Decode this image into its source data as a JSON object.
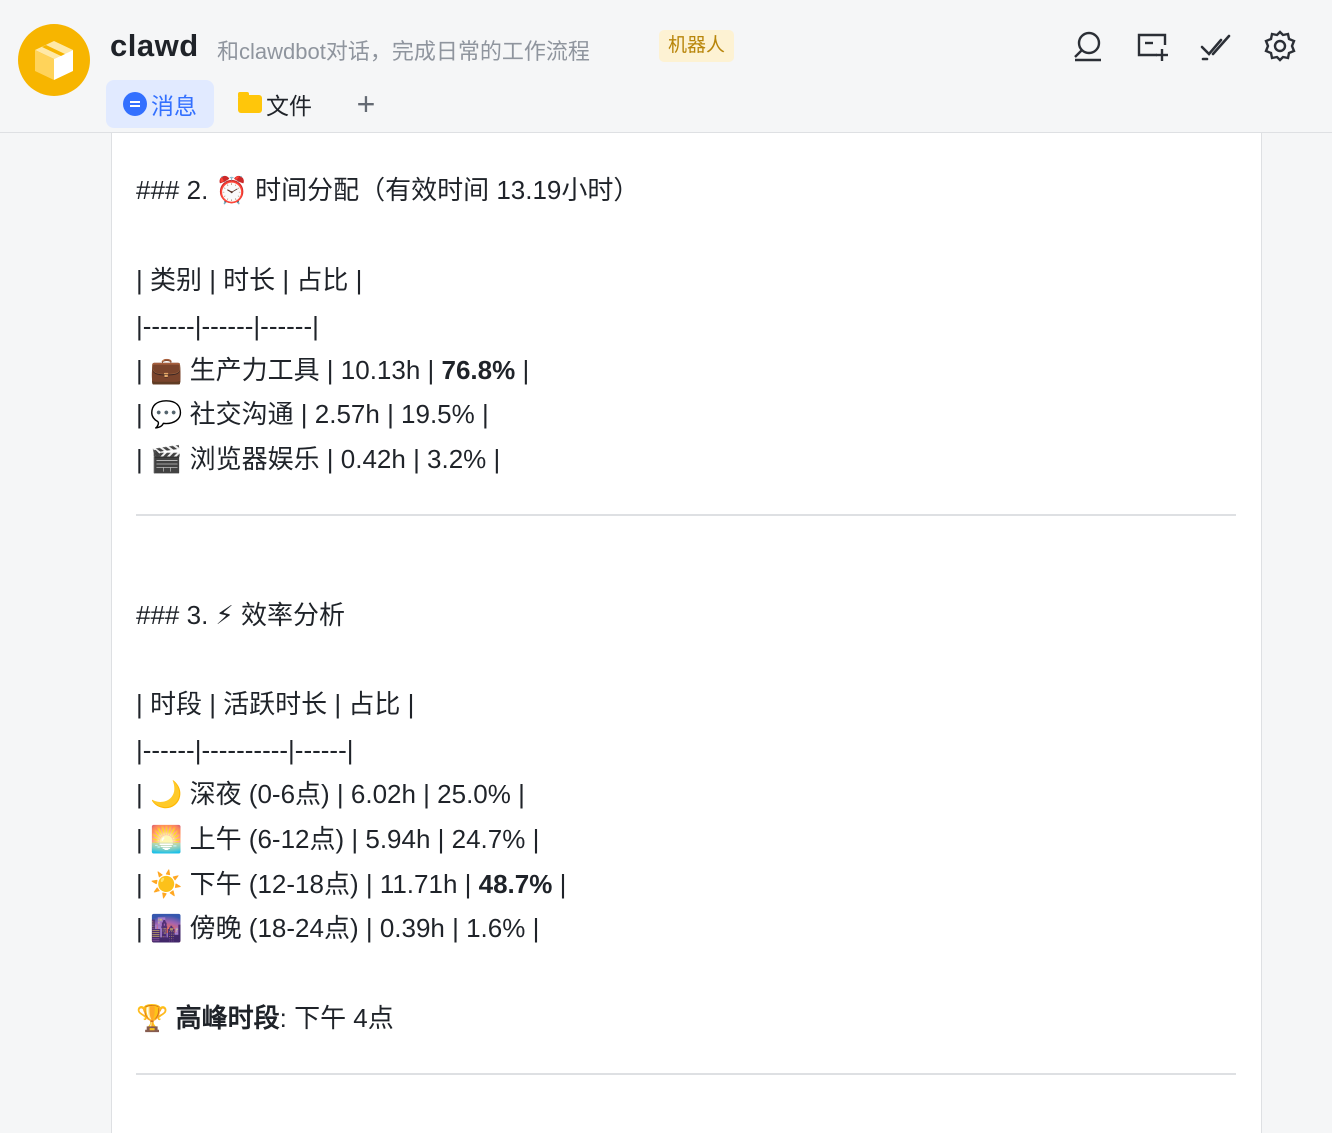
{
  "header": {
    "title": "clawd",
    "subtitle": "和clawdbot对话，完成日常的工作流程",
    "badge": "机器人",
    "tabs": {
      "messages": "消息",
      "files": "文件",
      "add": "+"
    }
  },
  "icons": {
    "avatar": "box-icon",
    "search": "search-icon",
    "new_window": "new-window-icon",
    "check": "double-check-icon",
    "settings": "gear-icon"
  },
  "colors": {
    "accent": "#3370ff",
    "avatar": "#f7b500",
    "badge_bg": "#fdf2d3",
    "badge_text": "#b8850a"
  },
  "content": {
    "sec2_title": "### 2. ⏰ 时间分配（有效时间 13.19小时）",
    "t1_header": "| 类别 | 时长 | 占比 |",
    "t1_sep": "|------|------|------|",
    "t1_r1_pre": "| 💼 生产力工具 | 10.13h | ",
    "t1_r1_bold": "76.8%",
    "t1_r1_post": " |",
    "t1_r2": "| 💬 社交沟通 | 2.57h | 19.5% |",
    "t1_r3": "| 🎬 浏览器娱乐 | 0.42h | 3.2% |",
    "sec3_title": "### 3. ⚡ 效率分析",
    "t2_header": "| 时段 | 活跃时长 | 占比 |",
    "t2_sep": "|------|----------|------|",
    "t2_r1": "| 🌙 深夜 (0-6点) | 6.02h | 25.0% |",
    "t2_r2": "| 🌅 上午 (6-12点) | 5.94h | 24.7% |",
    "t2_r3_pre": "| ☀️ 下午 (12-18点) | 11.71h | ",
    "t2_r3_bold": "48.7%",
    "t2_r3_post": " |",
    "t2_r4": "| 🌆 傍晚 (18-24点) | 0.39h | 1.6% |",
    "peak_emoji": "🏆",
    "peak_label": "高峰时段",
    "peak_value": ": 下午 4点"
  }
}
